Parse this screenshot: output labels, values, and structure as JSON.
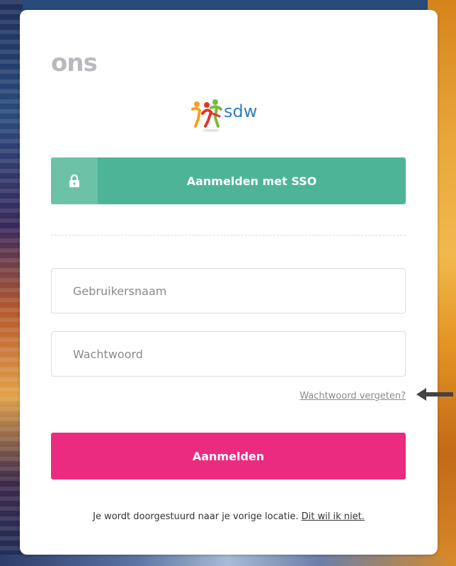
{
  "brand": {
    "text": "ons"
  },
  "logo": {
    "text": "sdw"
  },
  "sso_button": {
    "label": "Aanmelden met SSO",
    "icon": "lock-icon"
  },
  "username": {
    "value": "",
    "placeholder": "Gebruikersnaam"
  },
  "password": {
    "value": "",
    "placeholder": "Wachtwoord"
  },
  "forgot_link": {
    "label": "Wachtwoord vergeten?"
  },
  "submit_button": {
    "label": "Aanmelden"
  },
  "footer": {
    "text": "Je wordt doorgestuurd naar je vorige locatie.",
    "link": "Dit wil ik niet."
  },
  "colors": {
    "sso": "#4eb497",
    "sso_icon_box": "#6cc1a7",
    "submit": "#ea2b80",
    "brand": "#b7b9bd",
    "logo_text": "#2f7fc1"
  }
}
